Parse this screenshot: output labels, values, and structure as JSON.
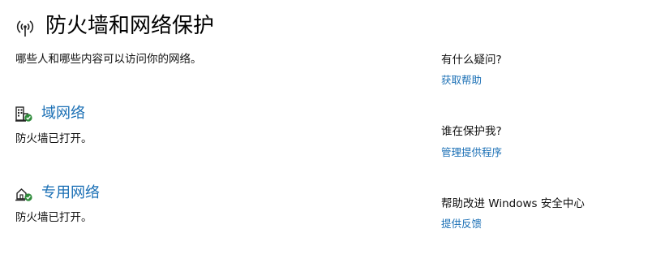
{
  "header": {
    "icon": "firewall-network-icon",
    "title": "防火墙和网络保护",
    "subtitle": "哪些人和哪些内容可以访问你的网络。"
  },
  "networks": [
    {
      "icon": "domain-network-icon",
      "name": "域网络",
      "status": "防火墙已打开。"
    },
    {
      "icon": "private-network-icon",
      "name": "专用网络",
      "status": "防火墙已打开。"
    }
  ],
  "side": {
    "help": {
      "question": "有什么疑问?",
      "link": "获取帮助"
    },
    "protector": {
      "question": "谁在保护我?",
      "link": "管理提供程序"
    },
    "improve": {
      "question": "帮助改进 Windows 安全中心",
      "link": "提供反馈"
    }
  },
  "colors": {
    "link": "#1a6fb5",
    "status_ok": "#2e8b3a"
  }
}
